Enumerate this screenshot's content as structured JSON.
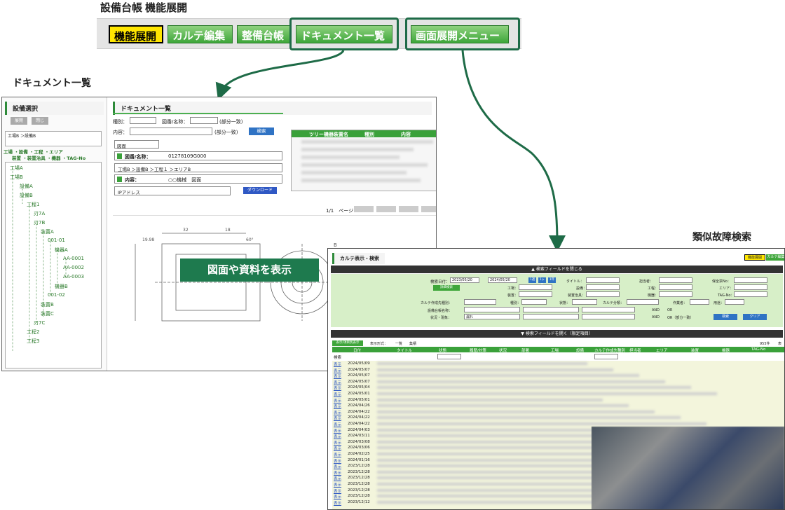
{
  "header": {
    "title": "設備台帳 機能展開"
  },
  "tabs": [
    {
      "label": "機能展開",
      "active": true
    },
    {
      "label": "カルテ編集"
    },
    {
      "label": "整備台帳"
    },
    {
      "label": "ドキュメント一覧"
    },
    {
      "label": "画面展開メニュー"
    }
  ],
  "doc_section": {
    "label": "ドキュメント一覧",
    "left_panel_title": "設備選択",
    "btn_expand": "展開",
    "btn_collapse": "閉じ",
    "path": "工場B ＞設備B",
    "tree_header_1": "工場 ・設備 ・工程 ・エリア",
    "tree_header_2": "装置 ・装置治具 ・機器 ・TAG-No",
    "tree": [
      "工場A",
      "工場B",
      "設備A",
      "設備B",
      "工程1",
      "刃7A",
      "刃7B",
      "装置A",
      "001-01",
      "機器A",
      "AA-0001",
      "AA-0002",
      "AA-0003",
      "機器B",
      "001-02",
      "装置B",
      "装置C",
      "刃7C",
      "工程2",
      "工程3"
    ],
    "main_title": "ドキュメント一覧",
    "type_label": "種別：",
    "drawing_label": "図番/名称：",
    "partial_match": "(部分一致)",
    "content_label": "内容：",
    "search_btn": "検索",
    "drawing_tag": "図面",
    "detail_drawing_label": "図番/名称：",
    "detail_drawing_value": "01278109G000",
    "detail_path": "工場B ＞設備B ＞工程１ ＞エリアB",
    "detail_content_label": "内容：",
    "detail_content_value": "○○機械　図面",
    "ip_label": "IPアドレス",
    "download_btn": "ダウンロード",
    "table_headers": [
      "ツリー機器装置名",
      "種別",
      "内容"
    ],
    "pagination": "1/1　ページ",
    "overlay": "図面や資料を表示",
    "dim_labels": [
      "32",
      "18",
      "60°",
      "19.98",
      "B"
    ]
  },
  "karte_section": {
    "label": "類似故障検索",
    "window_title": "カルテ表示・検索",
    "top_badges": [
      "機能展開",
      "カルテ編集"
    ],
    "search_bar": "▲ 検索フィールドを閉じる",
    "date_label": "検索日付：",
    "date_from": "2023/05/20",
    "date_to": "2024/05/20",
    "date_btns": [
      "1週",
      "1ヶ月",
      "1年"
    ],
    "cond_btn": "詳細検索",
    "form_labels": [
      "タイトル：",
      "担当者：",
      "保全票No：",
      "工場：",
      "設備：",
      "工程：",
      "エリア：",
      "装置：",
      "装置治具：",
      "機器：",
      "TAG-No：",
      "カルテ作成先種別：",
      "種別：",
      "状態：",
      "カルテ分類：",
      "作業者：",
      "用途：",
      "設備台帳名称：",
      "状況・現象："
    ],
    "status_value": "漏れ",
    "and_label": "AND",
    "or_label": "OR",
    "or_partial": "OR（部分一致）",
    "btn_search": "検索",
    "btn_clear": "クリア",
    "search_bar2": "▼ 検索フィールドを開く（限定項目）",
    "show_hide": "表示/項目別表示",
    "display_label": "表示形式：",
    "display_opt1": "一覧",
    "display_opt2": "集積",
    "count": "955件",
    "display_short": "表",
    "col_headers": [
      "日付",
      "タイトル",
      "状態",
      "履歴/対策",
      "状況",
      "部署",
      "工場",
      "設備",
      "カルテ作成先種別",
      "担当者",
      "エリア",
      "装置",
      "機器",
      "TAG-No"
    ],
    "filter_label": "検索",
    "row_link": "表示",
    "dates": [
      "2024/05/09",
      "2024/05/07",
      "2024/05/07",
      "2024/05/07",
      "2024/05/04",
      "2024/05/01",
      "2024/05/01",
      "2024/04/26",
      "2024/04/22",
      "2024/04/22",
      "2024/04/22",
      "2024/04/03",
      "2024/03/11",
      "2024/03/08",
      "2024/03/06",
      "2024/02/25",
      "2024/01/16",
      "2023/12/28",
      "2023/12/28",
      "2023/12/28",
      "2023/12/28",
      "2023/12/28",
      "2023/12/28",
      "2023/12/12"
    ]
  },
  "colors": {
    "accent": "#1e6b47",
    "green": "#3ea63a",
    "yellow": "#ffe600"
  }
}
